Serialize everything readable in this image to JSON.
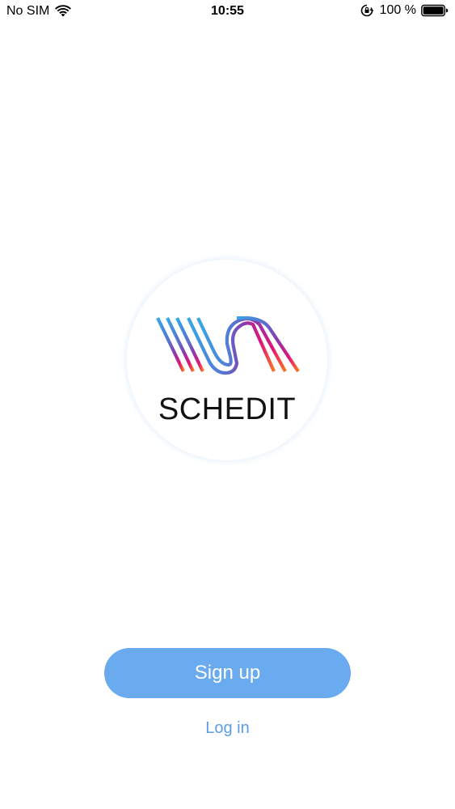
{
  "status_bar": {
    "carrier": "No SIM",
    "time": "10:55",
    "battery_percent": "100 %",
    "icons": [
      "wifi-icon",
      "orientation-lock-icon",
      "battery-icon"
    ]
  },
  "logo": {
    "text": "SCHEDIT",
    "colors": [
      "#3aa0e8",
      "#7b3fb0",
      "#e3127a",
      "#f5781f"
    ]
  },
  "actions": {
    "signup_label": "Sign up",
    "login_label": "Log in"
  },
  "colors": {
    "primary_button": "#6aaaee",
    "link": "#5a9de3"
  }
}
